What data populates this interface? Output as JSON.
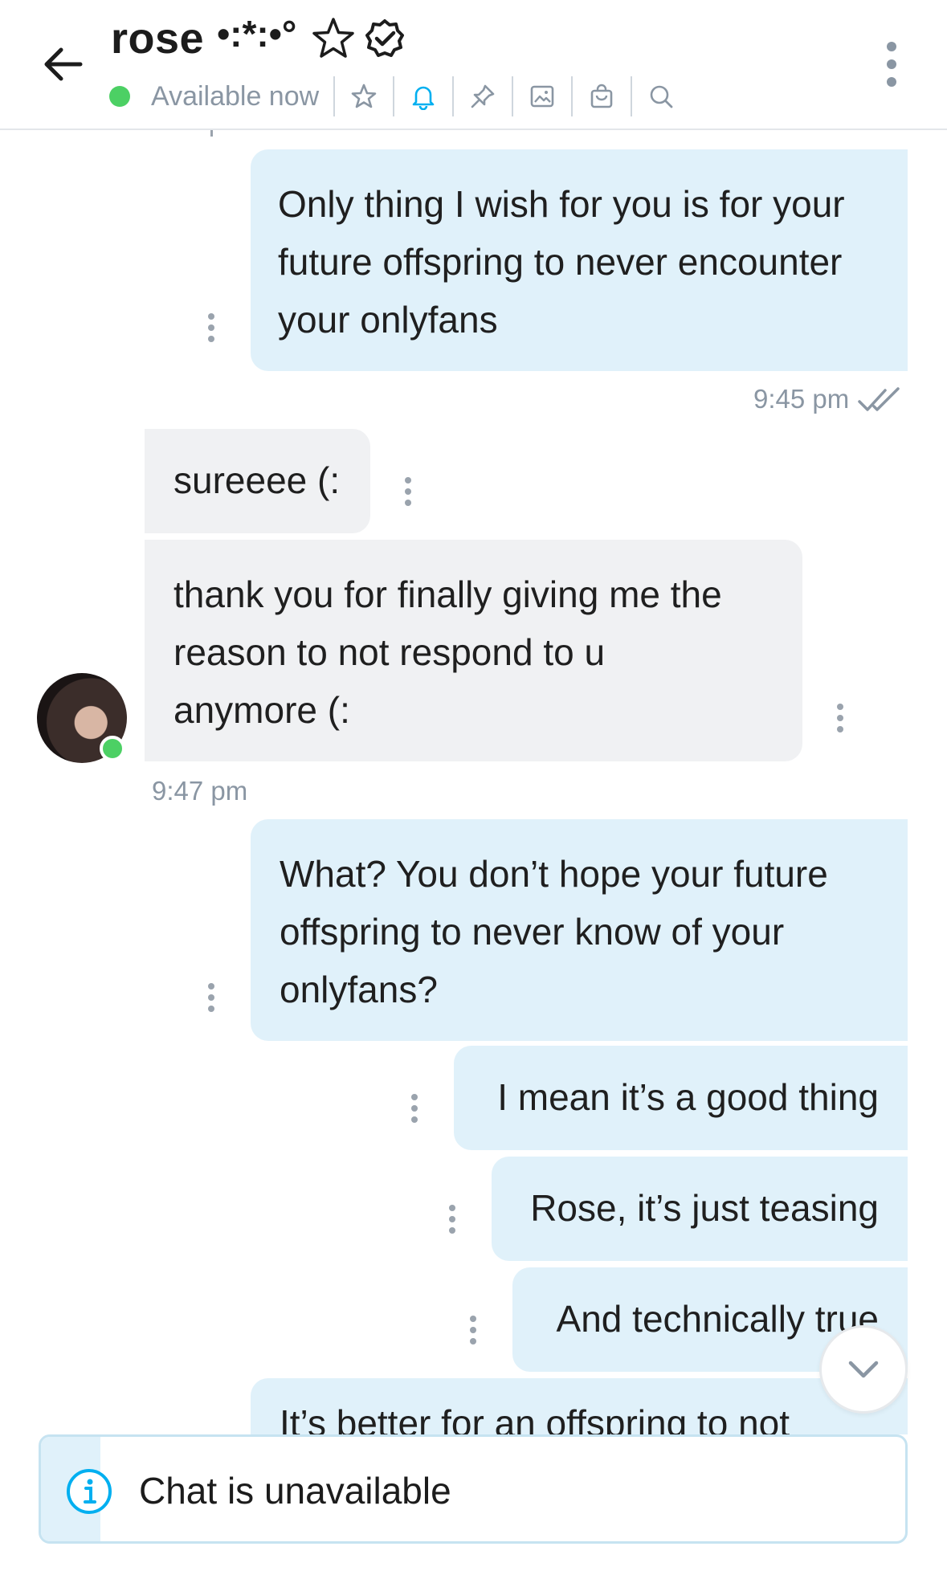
{
  "header": {
    "title": "rose",
    "title_decoration": "•:*:•°",
    "status": "Available now",
    "icons": [
      "back-arrow-icon",
      "star-outline-icon",
      "verified-badge-icon",
      "more-vertical-icon",
      "star-icon",
      "bell-icon",
      "pin-icon",
      "image-icon",
      "bag-icon",
      "search-icon"
    ],
    "accent_color": "#00aff0",
    "online_color": "#4cd064"
  },
  "messages": [
    {
      "side": "out",
      "lines": [
        "Only thing I wish for you is for your",
        "future offspring to never encounter",
        "your onlyfans"
      ]
    },
    {
      "side": "out-time",
      "time": "9:45 pm"
    },
    {
      "side": "in",
      "lines": [
        "sureeee (:"
      ]
    },
    {
      "side": "in",
      "lines": [
        "thank you for finally giving me the",
        "reason to not respond to u",
        "anymore (:"
      ]
    },
    {
      "side": "in-time",
      "time": "9:47 pm"
    },
    {
      "side": "out",
      "lines": [
        "What? You don’t hope your future",
        "offspring to never know of your",
        "onlyfans?"
      ]
    },
    {
      "side": "out",
      "lines": [
        "I mean it’s a good thing"
      ]
    },
    {
      "side": "out",
      "lines": [
        "Rose, it’s just teasing"
      ]
    },
    {
      "side": "out",
      "lines": [
        "And technically true"
      ]
    },
    {
      "side": "out",
      "lines": [
        "It’s better for an offspring to not"
      ]
    }
  ],
  "banner": {
    "text": "Chat is unavailable",
    "icon": "info-icon"
  }
}
